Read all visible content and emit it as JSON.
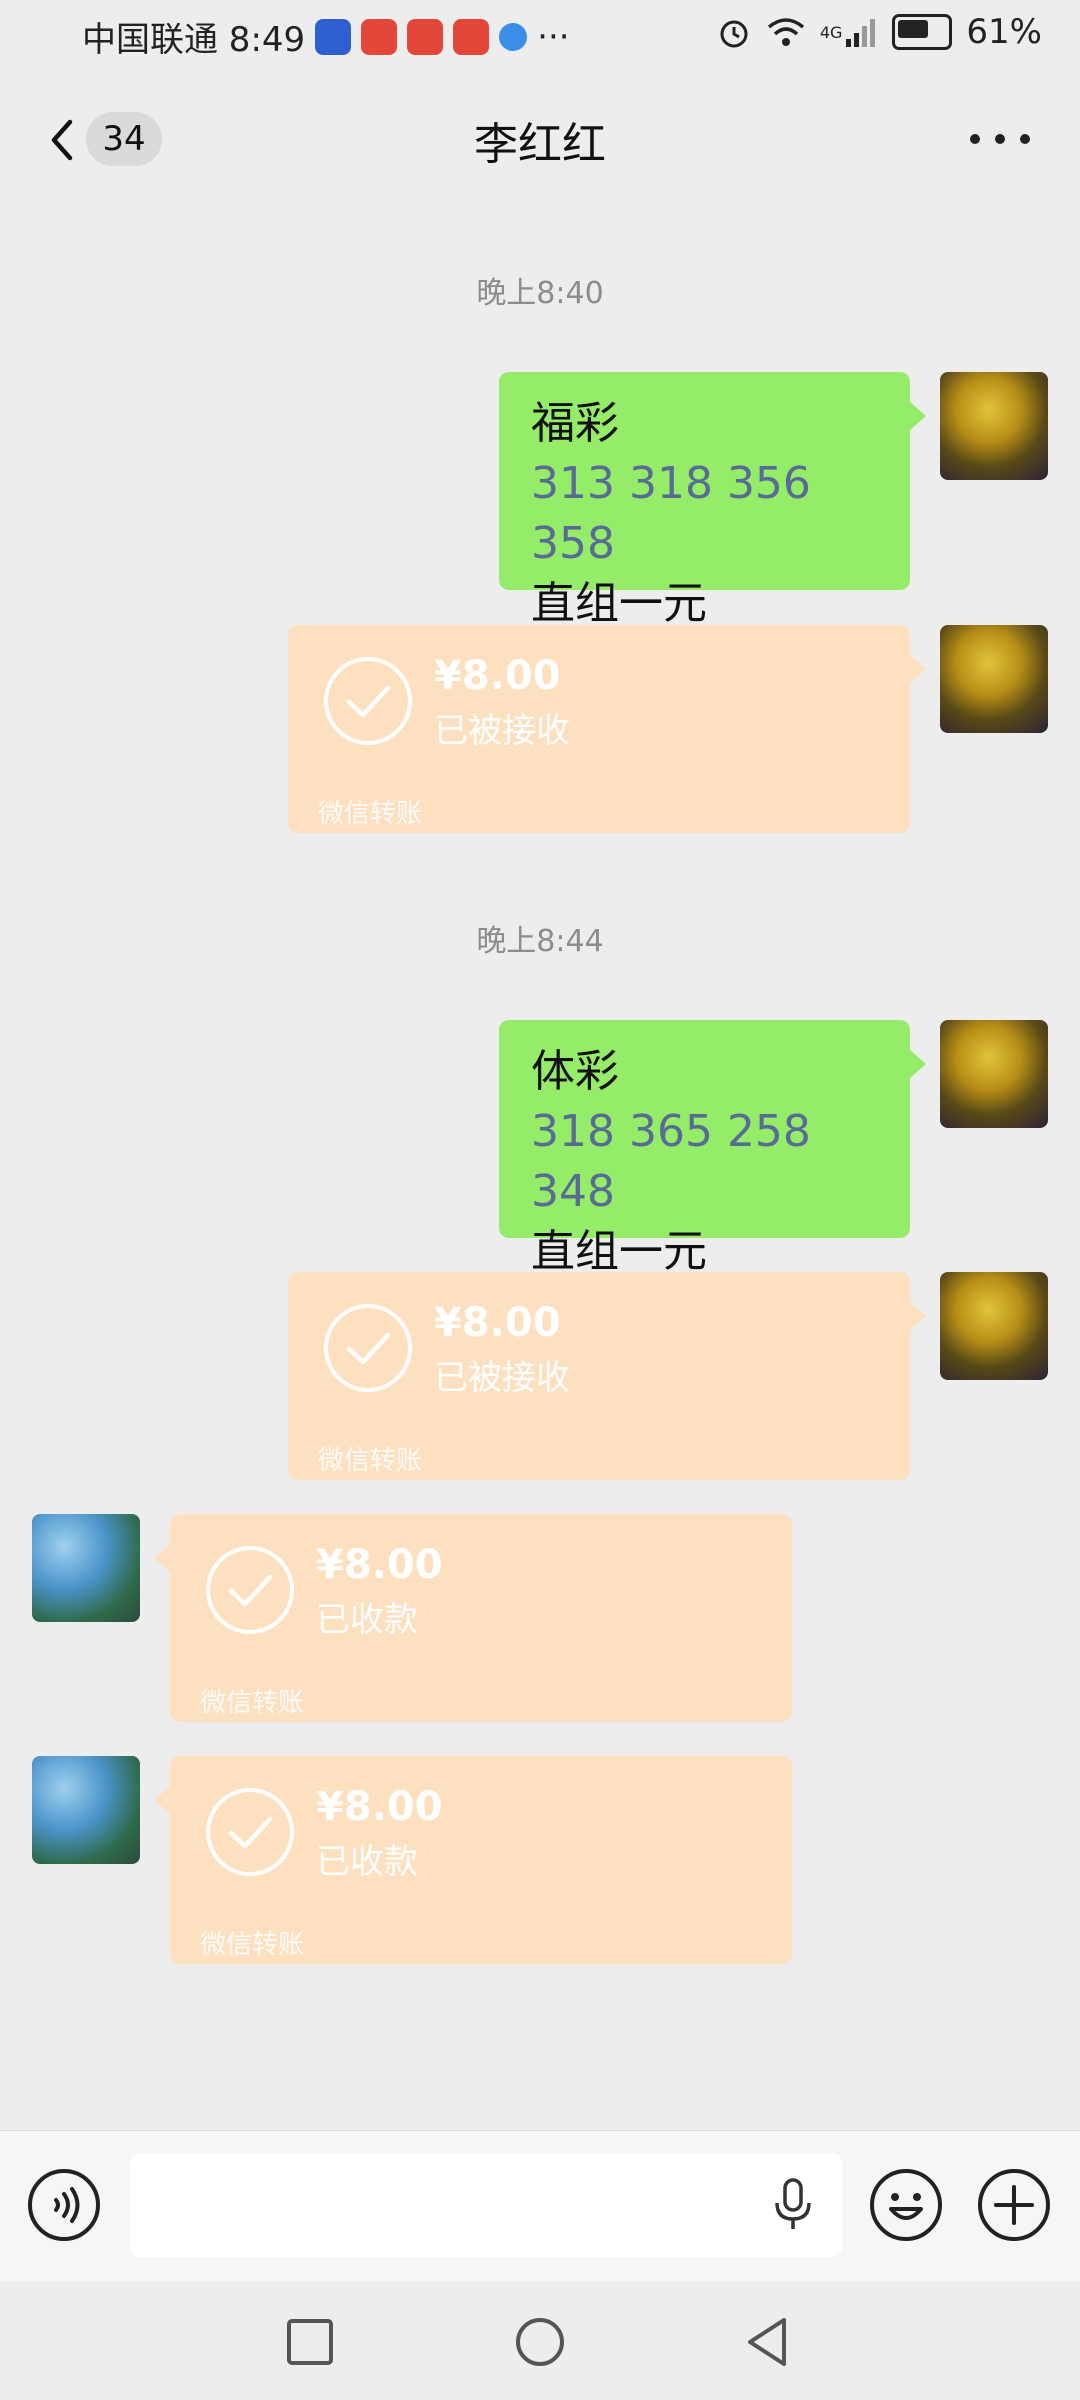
{
  "status_bar": {
    "carrier_time": "中国联通 8:49",
    "extra": "···",
    "network": "4G",
    "battery": "61%"
  },
  "navbar": {
    "unread_count": "34",
    "title": "李红红"
  },
  "messages": [
    {
      "type": "timestamp",
      "text": "晚上8:40"
    },
    {
      "type": "text",
      "side": "right",
      "line1": "福彩",
      "numbers": "313 318 356 358",
      "line3": "直组一元"
    },
    {
      "type": "transfer",
      "side": "right",
      "amount": "¥8.00",
      "status": "已被接收",
      "footer": "微信转账"
    },
    {
      "type": "timestamp",
      "text": "晚上8:44"
    },
    {
      "type": "text",
      "side": "right",
      "line1": "体彩",
      "numbers": "318 365 258 348",
      "line3": "直组一元"
    },
    {
      "type": "transfer",
      "side": "right",
      "amount": "¥8.00",
      "status": "已被接收",
      "footer": "微信转账"
    },
    {
      "type": "transfer",
      "side": "left",
      "amount": "¥8.00",
      "status": "已收款",
      "footer": "微信转账"
    },
    {
      "type": "transfer",
      "side": "left",
      "amount": "¥8.00",
      "status": "已收款",
      "footer": "微信转账"
    }
  ],
  "input_bar": {
    "placeholder": ""
  },
  "colors": {
    "background": "#ededed",
    "self_bubble": "#95ec69",
    "transfer_bubble": "#fde0bf",
    "number_text": "#576b95"
  },
  "icons": [
    "back-icon",
    "more-icon",
    "voice-icon",
    "mic-icon",
    "emoji-icon",
    "plus-icon",
    "recent-apps-icon",
    "home-icon",
    "back-nav-icon",
    "check-icon"
  ]
}
